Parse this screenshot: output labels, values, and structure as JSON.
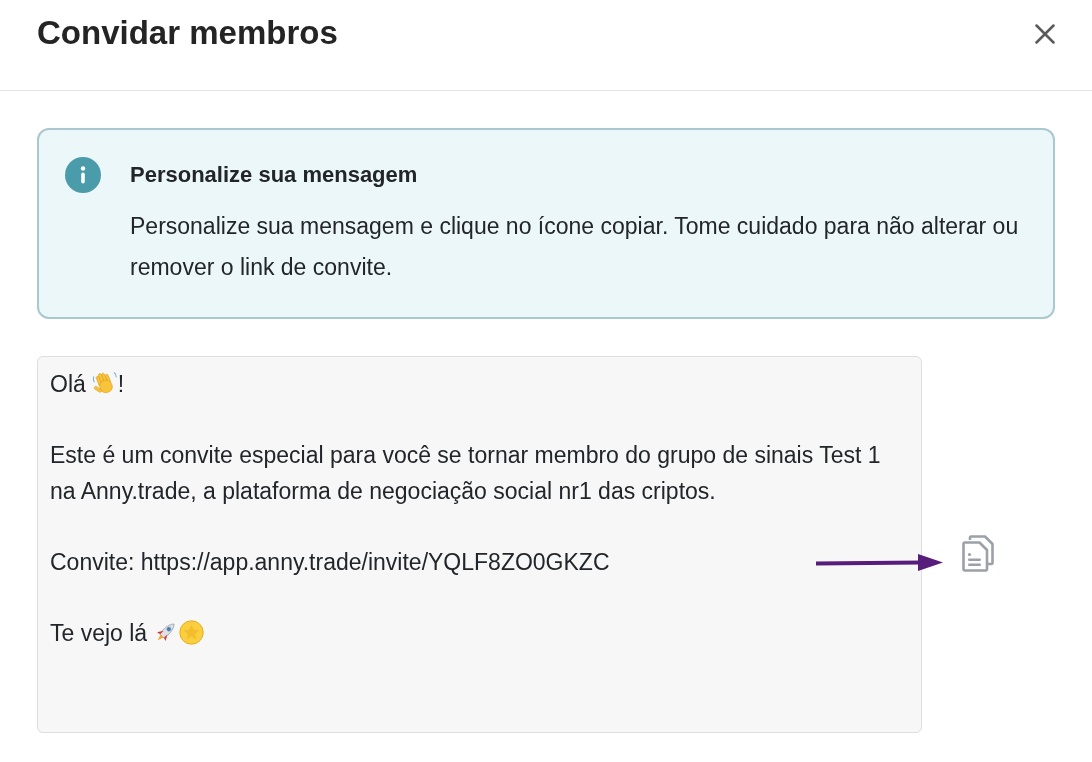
{
  "dialog": {
    "title": "Convidar membros"
  },
  "notice": {
    "title": "Personalize sua mensagem",
    "text": "Personalize sua mensagem e clique no ícone copiar. Tome cuidado para não alterar ou remover o link de convite."
  },
  "message": {
    "paragraphs": [
      {
        "parts": [
          {
            "kind": "text",
            "text": "Olá"
          },
          {
            "kind": "wave"
          },
          {
            "kind": "text",
            "text": "!"
          }
        ]
      },
      {
        "parts": [
          {
            "kind": "text",
            "text": "Este é um convite especial para você se tornar membro do grupo de sinais Test 1 na Anny.trade, a plataforma de negociação social nr1 das criptos."
          }
        ]
      },
      {
        "parts": [
          {
            "kind": "text",
            "text": "Convite: https://app.anny.trade/invite/YQLF8ZO0GKZC"
          }
        ]
      },
      {
        "parts": [
          {
            "kind": "text",
            "text": "Te vejo lá"
          },
          {
            "kind": "rocket"
          },
          {
            "kind": "coin"
          }
        ]
      }
    ]
  }
}
